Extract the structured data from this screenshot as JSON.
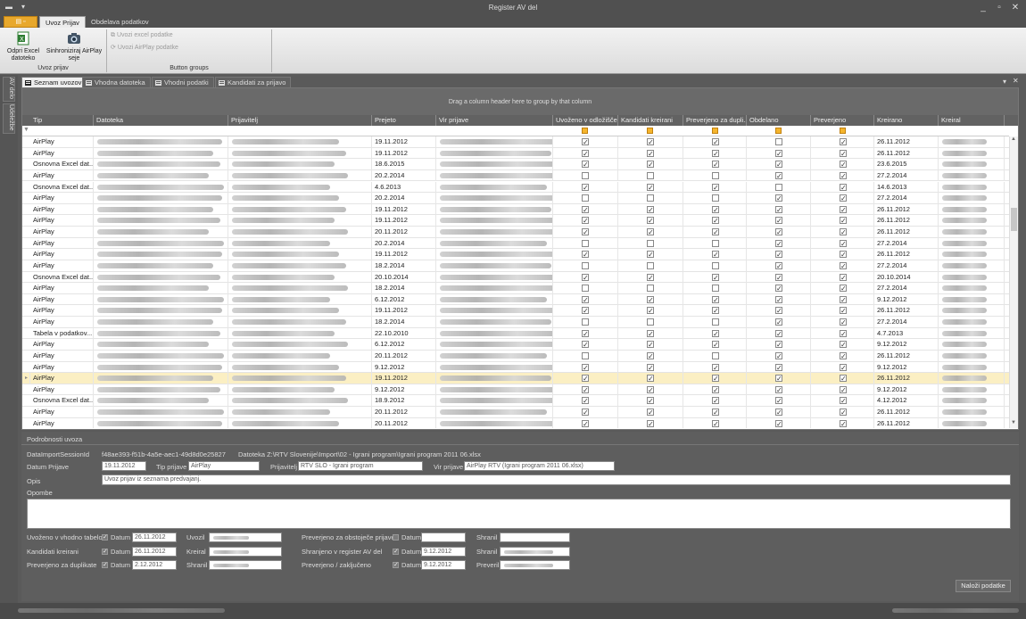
{
  "window": {
    "title": "Register AV del",
    "app_menu_label": "",
    "minimize": "_",
    "restore": "▫",
    "close": "✕"
  },
  "ribbon": {
    "tabs": [
      "Uvoz Prijav",
      "Obdelava podatkov"
    ],
    "buttons": {
      "open_excel": "Odpri Excel datoteko",
      "sync_airplay": "Sinhroniziraj AirPlay seje",
      "import_excel": "Uvozi excel podatke",
      "import_airplay": "Uvozi AirPlay podatke"
    },
    "groups": [
      "Uvoz prijav",
      "Button groups"
    ]
  },
  "side_tabs": [
    "AV delo",
    "Udeležbe"
  ],
  "doc_tabs": [
    "Seznam uvozov",
    "Vhodna datoteka",
    "Vhodni podatki",
    "Kandidati za prijavo"
  ],
  "grid": {
    "group_hint": "Drag a column header here to group by that column",
    "columns": [
      "Tip",
      "Datoteka",
      "Prijavitelj",
      "Prejeto",
      "Vir prijave",
      "Uvoženo v odložišče",
      "Kandidati kreirani",
      "Preverjeno za dupli...",
      "Obdelano",
      "Preverjeno",
      "Kreirano",
      "Kreiral"
    ],
    "selected_index": 21,
    "rows": [
      {
        "tip": "AirPlay",
        "prejeto": "19.11.2012",
        "uv": 1,
        "ka": 1,
        "pr": 1,
        "ob": 0,
        "pv": 1,
        "kreirano": "26.11.2012"
      },
      {
        "tip": "AirPlay",
        "prejeto": "19.11.2012",
        "uv": 1,
        "ka": 1,
        "pr": 1,
        "ob": 1,
        "pv": 1,
        "kreirano": "26.11.2012"
      },
      {
        "tip": "Osnovna Excel dat...",
        "prejeto": "18.6.2015",
        "uv": 1,
        "ka": 1,
        "pr": 1,
        "ob": 1,
        "pv": 1,
        "kreirano": "23.6.2015"
      },
      {
        "tip": "AirPlay",
        "prejeto": "20.2.2014",
        "uv": 0,
        "ka": 0,
        "pr": 0,
        "ob": 1,
        "pv": 1,
        "kreirano": "27.2.2014"
      },
      {
        "tip": "Osnovna Excel dat...",
        "prejeto": "4.6.2013",
        "uv": 1,
        "ka": 1,
        "pr": 1,
        "ob": 0,
        "pv": 1,
        "kreirano": "14.6.2013"
      },
      {
        "tip": "AirPlay",
        "prejeto": "20.2.2014",
        "uv": 0,
        "ka": 0,
        "pr": 0,
        "ob": 1,
        "pv": 1,
        "kreirano": "27.2.2014"
      },
      {
        "tip": "AirPlay",
        "prejeto": "19.11.2012",
        "uv": 1,
        "ka": 1,
        "pr": 1,
        "ob": 1,
        "pv": 1,
        "kreirano": "26.11.2012"
      },
      {
        "tip": "AirPlay",
        "prejeto": "19.11.2012",
        "uv": 1,
        "ka": 1,
        "pr": 1,
        "ob": 1,
        "pv": 1,
        "kreirano": "26.11.2012"
      },
      {
        "tip": "AirPlay",
        "prejeto": "20.11.2012",
        "uv": 1,
        "ka": 1,
        "pr": 1,
        "ob": 1,
        "pv": 1,
        "kreirano": "26.11.2012"
      },
      {
        "tip": "AirPlay",
        "prejeto": "20.2.2014",
        "uv": 0,
        "ka": 0,
        "pr": 0,
        "ob": 1,
        "pv": 1,
        "kreirano": "27.2.2014"
      },
      {
        "tip": "AirPlay",
        "prejeto": "19.11.2012",
        "uv": 1,
        "ka": 1,
        "pr": 1,
        "ob": 1,
        "pv": 1,
        "kreirano": "26.11.2012"
      },
      {
        "tip": "AirPlay",
        "prejeto": "18.2.2014",
        "uv": 0,
        "ka": 0,
        "pr": 0,
        "ob": 1,
        "pv": 1,
        "kreirano": "27.2.2014"
      },
      {
        "tip": "Osnovna Excel dat...",
        "prejeto": "20.10.2014",
        "uv": 1,
        "ka": 1,
        "pr": 1,
        "ob": 1,
        "pv": 1,
        "kreirano": "20.10.2014"
      },
      {
        "tip": "AirPlay",
        "prejeto": "18.2.2014",
        "uv": 0,
        "ka": 0,
        "pr": 0,
        "ob": 1,
        "pv": 1,
        "kreirano": "27.2.2014"
      },
      {
        "tip": "AirPlay",
        "prejeto": "6.12.2012",
        "uv": 1,
        "ka": 1,
        "pr": 1,
        "ob": 1,
        "pv": 1,
        "kreirano": "9.12.2012"
      },
      {
        "tip": "AirPlay",
        "prejeto": "19.11.2012",
        "uv": 1,
        "ka": 1,
        "pr": 1,
        "ob": 1,
        "pv": 1,
        "kreirano": "26.11.2012"
      },
      {
        "tip": "AirPlay",
        "prejeto": "18.2.2014",
        "uv": 0,
        "ka": 0,
        "pr": 0,
        "ob": 1,
        "pv": 1,
        "kreirano": "27.2.2014"
      },
      {
        "tip": "Tabela v podatkov...",
        "prejeto": "22.10.2010",
        "uv": 1,
        "ka": 1,
        "pr": 1,
        "ob": 1,
        "pv": 1,
        "kreirano": "4.7.2013"
      },
      {
        "tip": "AirPlay",
        "prejeto": "6.12.2012",
        "uv": 1,
        "ka": 1,
        "pr": 1,
        "ob": 1,
        "pv": 1,
        "kreirano": "9.12.2012"
      },
      {
        "tip": "AirPlay",
        "prejeto": "20.11.2012",
        "uv": 0,
        "ka": 1,
        "pr": 0,
        "ob": 1,
        "pv": 1,
        "kreirano": "26.11.2012"
      },
      {
        "tip": "AirPlay",
        "prejeto": "9.12.2012",
        "uv": 1,
        "ka": 1,
        "pr": 1,
        "ob": 1,
        "pv": 1,
        "kreirano": "9.12.2012"
      },
      {
        "tip": "AirPlay",
        "prejeto": "19.11.2012",
        "uv": 1,
        "ka": 1,
        "pr": 1,
        "ob": 1,
        "pv": 1,
        "kreirano": "26.11.2012"
      },
      {
        "tip": "AirPlay",
        "prejeto": "9.12.2012",
        "uv": 1,
        "ka": 1,
        "pr": 1,
        "ob": 1,
        "pv": 1,
        "kreirano": "9.12.2012"
      },
      {
        "tip": "Osnovna Excel dat...",
        "prejeto": "18.9.2012",
        "uv": 1,
        "ka": 1,
        "pr": 1,
        "ob": 1,
        "pv": 1,
        "kreirano": "4.12.2012"
      },
      {
        "tip": "AirPlay",
        "prejeto": "20.11.2012",
        "uv": 1,
        "ka": 1,
        "pr": 1,
        "ob": 1,
        "pv": 1,
        "kreirano": "26.11.2012"
      },
      {
        "tip": "AirPlay",
        "prejeto": "20.11.2012",
        "uv": 1,
        "ka": 1,
        "pr": 1,
        "ob": 1,
        "pv": 1,
        "kreirano": "26.11.2012"
      }
    ]
  },
  "details": {
    "header": "Podrobnosti uvoza",
    "session_label": "DataImportSessionId",
    "session_id": "f48ae393-f51b-4a5e-aec1-49d8d0e25827",
    "file_text": "Datoteka Z:\\RTV Slovenije\\Import\\02 - Igrani program\\Igrani program 2011 06.xlsx",
    "datum_prijave_label": "Datum Prijave",
    "datum_prijave": "19.11.2012",
    "tip_prijave_label": "Tip prijave",
    "tip_prijave": "AirPlay",
    "prijavitelj_label": "Prijavitelj",
    "prijavitelj": "RTV SLO - Igrani program",
    "vir_prijave_label": "Vir prijave",
    "vir_prijave": "AirPlay RTV (Igrani program 2011 06.xlsx)",
    "opis_label": "Opis",
    "opis": "Uvoz prijav iz seznama predvajanj.",
    "opombe_label": "Opombe",
    "left_rows": [
      {
        "label": "Uvoženo v vhodno tabelo",
        "datum": "26.11.2012",
        "who_label": "Uvozil"
      },
      {
        "label": "Kandidati kreirani",
        "datum": "26.11.2012",
        "who_label": "Kreiral"
      },
      {
        "label": "Preverjeno za duplikate",
        "datum": "2.12.2012",
        "who_label": "Shranil"
      }
    ],
    "right_rows": [
      {
        "label": "Preverjeno za obstoječe prijave",
        "datum": "",
        "who_label": "Shranil"
      },
      {
        "label": "Shranjeno v register AV del",
        "datum": "9.12.2012",
        "who_label": "Shranil"
      },
      {
        "label": "Preverjeno / zaključeno",
        "datum": "9.12.2012",
        "who_label": "Preveril"
      }
    ],
    "datum_label": "Datum",
    "load_button": "Naloži podatke"
  }
}
